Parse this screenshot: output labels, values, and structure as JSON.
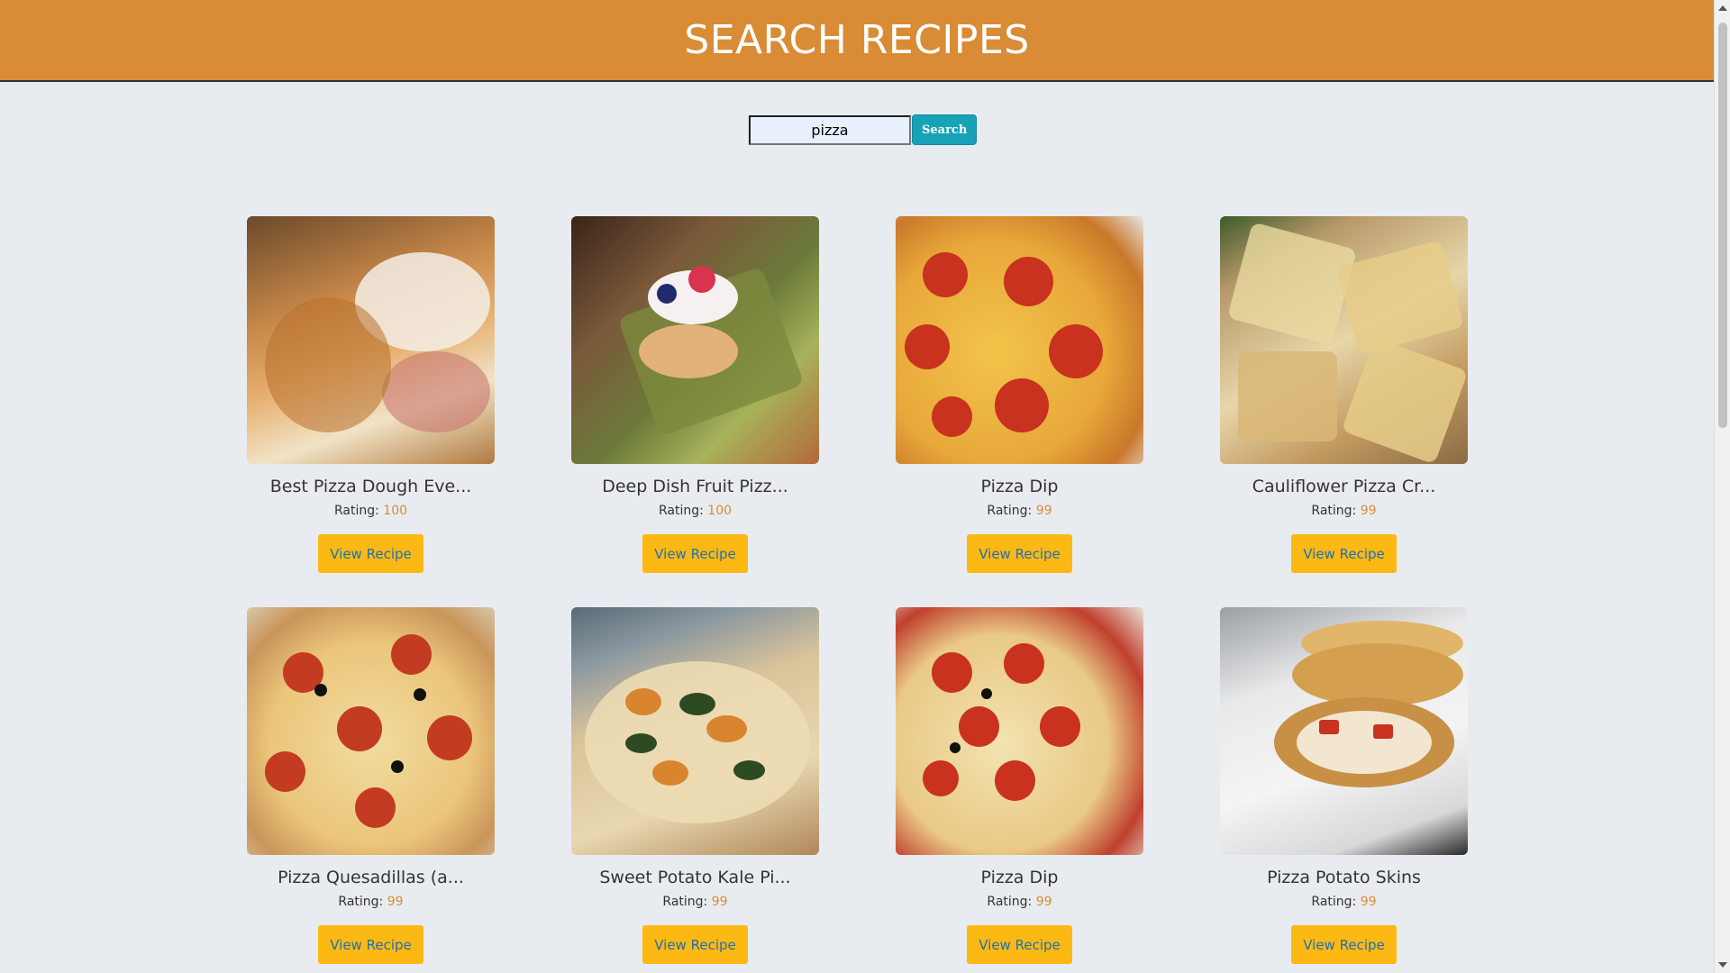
{
  "header": {
    "title": "SEARCH RECIPES"
  },
  "search": {
    "value": "pizza",
    "button_label": "Search"
  },
  "recipes": [
    {
      "title": "Best Pizza Dough Eve...",
      "rating_label": "Rating:",
      "rating": "100",
      "button_label": "View Recipe",
      "image": "pizza-dough-photo"
    },
    {
      "title": "Deep Dish Fruit Pizz...",
      "rating_label": "Rating:",
      "rating": "100",
      "button_label": "View Recipe",
      "image": "fruit-pizza-photo"
    },
    {
      "title": "Pizza Dip",
      "rating_label": "Rating:",
      "rating": "99",
      "button_label": "View Recipe",
      "image": "pizza-dip-photo"
    },
    {
      "title": "Cauliflower Pizza Cr...",
      "rating_label": "Rating:",
      "rating": "99",
      "button_label": "View Recipe",
      "image": "cauliflower-pizza-photo"
    },
    {
      "title": "Pizza Quesadillas (a...",
      "rating_label": "Rating:",
      "rating": "99",
      "button_label": "View Recipe",
      "image": "pizza-quesadillas-photo"
    },
    {
      "title": "Sweet Potato Kale Pi...",
      "rating_label": "Rating:",
      "rating": "99",
      "button_label": "View Recipe",
      "image": "sweet-potato-kale-pizza-photo"
    },
    {
      "title": "Pizza Dip",
      "rating_label": "Rating:",
      "rating": "99",
      "button_label": "View Recipe",
      "image": "pizza-dip-skillet-photo"
    },
    {
      "title": "Pizza Potato Skins",
      "rating_label": "Rating:",
      "rating": "99",
      "button_label": "View Recipe",
      "image": "pizza-potato-skins-photo"
    }
  ],
  "colors": {
    "header": "#d98b35",
    "search_button": "#17a2b8",
    "view_button": "#fcb913",
    "rating_value": "#d98b35"
  }
}
